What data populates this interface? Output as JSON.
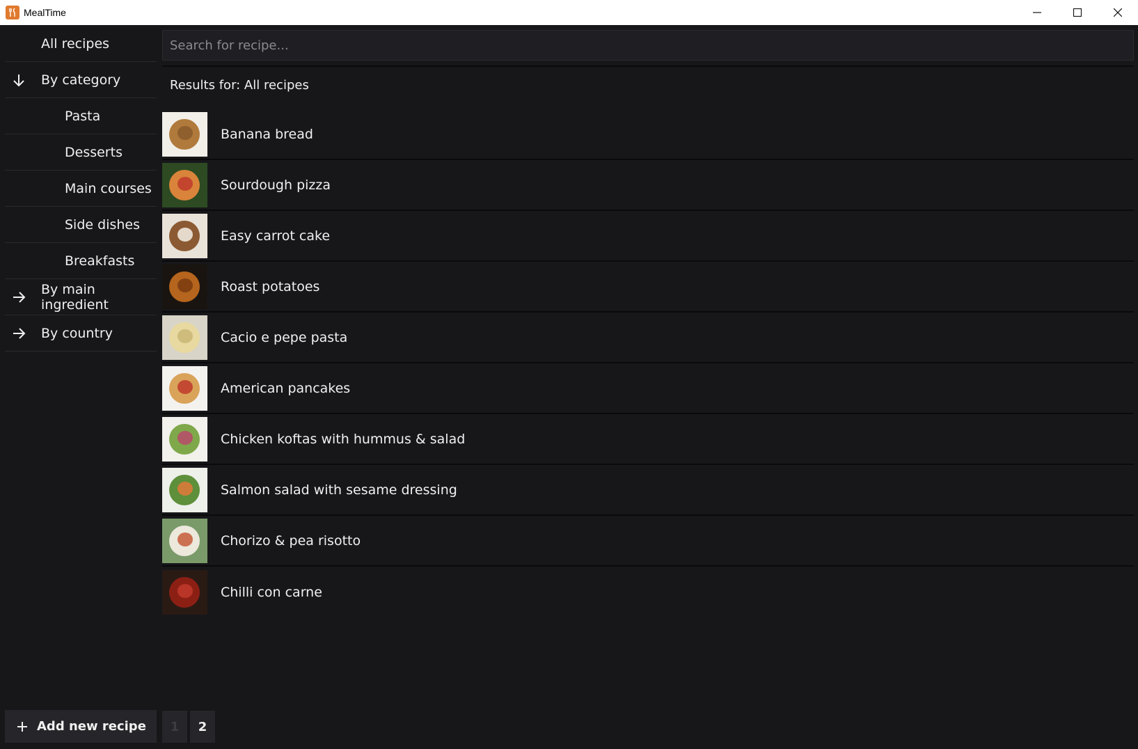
{
  "window": {
    "title": "MealTime",
    "icon": "fork-knife-icon"
  },
  "sidebar": {
    "items": [
      {
        "label": "All recipes",
        "arrow": null,
        "sub": false
      },
      {
        "label": "By category",
        "arrow": "down",
        "sub": false
      },
      {
        "label": "Pasta",
        "arrow": null,
        "sub": true
      },
      {
        "label": "Desserts",
        "arrow": null,
        "sub": true
      },
      {
        "label": "Main courses",
        "arrow": null,
        "sub": true
      },
      {
        "label": "Side dishes",
        "arrow": null,
        "sub": true
      },
      {
        "label": "Breakfasts",
        "arrow": null,
        "sub": true
      },
      {
        "label": "By main ingredient",
        "arrow": "right",
        "sub": false
      },
      {
        "label": "By country",
        "arrow": "right",
        "sub": false
      }
    ],
    "add_button": "Add new recipe"
  },
  "search": {
    "placeholder": "Search for recipe...",
    "value": ""
  },
  "results": {
    "label": "Results for: All recipes"
  },
  "recipes": [
    {
      "name": "Banana bread",
      "colors": [
        "#f2efe9",
        "#b07a3c",
        "#8a5a2b"
      ]
    },
    {
      "name": "Sourdough pizza",
      "colors": [
        "#2d4a22",
        "#d9843a",
        "#c0392b"
      ]
    },
    {
      "name": "Easy carrot cake",
      "colors": [
        "#e9e2d8",
        "#8b5a33",
        "#f5f0e6"
      ]
    },
    {
      "name": "Roast potatoes",
      "colors": [
        "#1a1410",
        "#b5651d",
        "#7a3b10"
      ]
    },
    {
      "name": "Cacio e pepe  pasta",
      "colors": [
        "#d8d4c8",
        "#e8d9a0",
        "#c9b676"
      ]
    },
    {
      "name": "American pancakes",
      "colors": [
        "#f4f2ef",
        "#d9a35a",
        "#c0392b"
      ]
    },
    {
      "name": "Chicken koftas with hummus & salad",
      "colors": [
        "#f2f1ec",
        "#7fa84a",
        "#b84a6a"
      ]
    },
    {
      "name": "Salmon salad with sesame dressing",
      "colors": [
        "#eef0ea",
        "#5e8f3a",
        "#e07a3a"
      ]
    },
    {
      "name": "Chorizo & pea risotto",
      "colors": [
        "#7a9a6a",
        "#ece8dc",
        "#c75a3a"
      ]
    },
    {
      "name": "Chilli con carne",
      "colors": [
        "#2a1a14",
        "#8c1f14",
        "#c0392b"
      ]
    }
  ],
  "pagination": {
    "pages": [
      "1",
      "2"
    ],
    "current": "1"
  }
}
